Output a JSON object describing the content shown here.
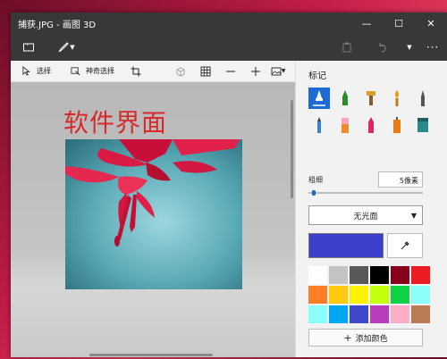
{
  "window": {
    "title": "捕获.JPG - 画图 3D"
  },
  "titlebar": {
    "minimize": "—",
    "maximize": "☐",
    "close": "✕"
  },
  "toolbar": {
    "select_label": "选择",
    "magic_select_label": "神奇选择"
  },
  "canvas": {
    "text": "软件界面"
  },
  "panel": {
    "title": "标记",
    "thickness_label": "粗细",
    "thickness_value": "5像素",
    "finish_value": "无光面",
    "add_color_label": "添加颜色",
    "brushes": [
      "marker-icon",
      "calligraphy-pen-icon",
      "oil-brush-icon",
      "watercolor-icon",
      "pixel-pen-icon",
      "pencil-icon",
      "eraser-icon",
      "crayon-icon",
      "spray-can-icon",
      "fill-icon"
    ],
    "main_color": "#3b3fc9",
    "palette": [
      "#ffffff",
      "#c3c3c3",
      "#585858",
      "#000000",
      "#88001b",
      "#ec1c24",
      "#ff7f27",
      "#ffc90e",
      "#fff200",
      "#c4ff0e",
      "#0ed145",
      "#8cfffb",
      "#8cfffb",
      "#00a8f3",
      "#3f48cc",
      "#b83dba",
      "#ffaec8",
      "#b97a56"
    ]
  }
}
